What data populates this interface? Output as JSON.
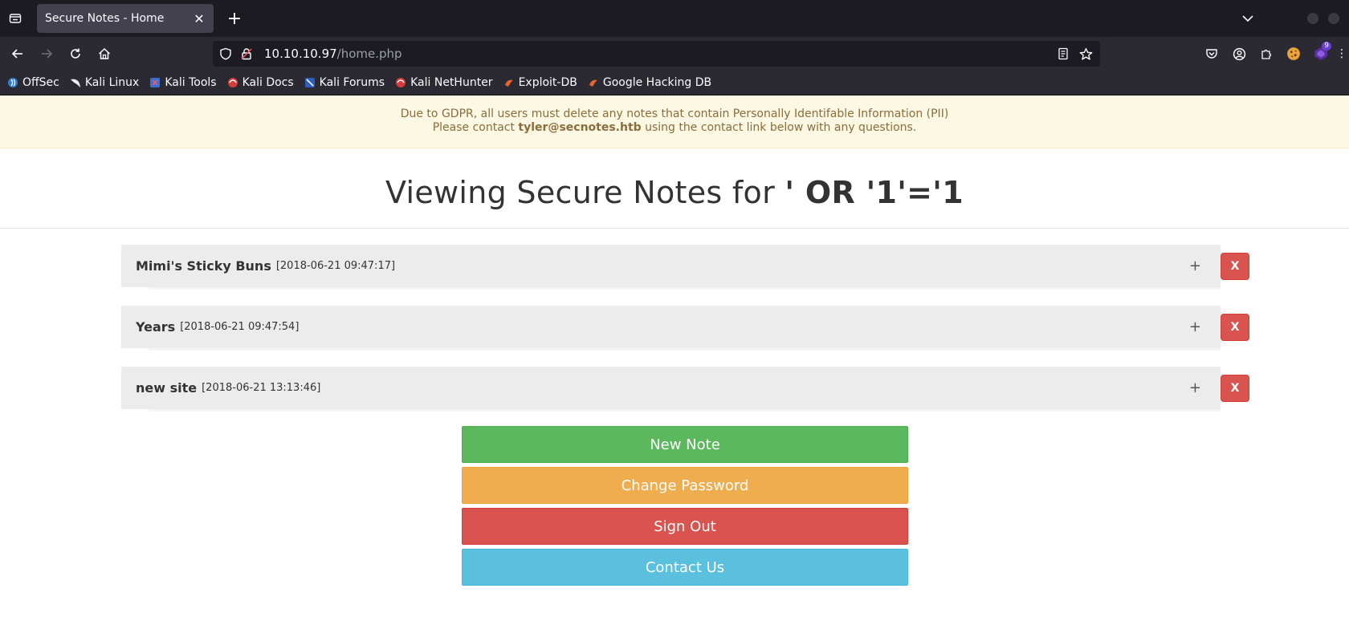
{
  "browser": {
    "tab_title": "Secure Notes - Home",
    "url_host": "10.10.10.97",
    "url_path": "/home.php",
    "extension_badge": "9",
    "bookmarks": [
      "OffSec",
      "Kali Linux",
      "Kali Tools",
      "Kali Docs",
      "Kali Forums",
      "Kali NetHunter",
      "Exploit-DB",
      "Google Hacking DB"
    ]
  },
  "banner": {
    "line1": "Due to GDPR, all users must delete any notes that contain Personally Identifable Information (PII)",
    "line2_prefix": "Please contact ",
    "contact_email": "tyler@secnotes.htb",
    "line2_suffix": " using the contact link below with any questions."
  },
  "heading": {
    "prefix": "Viewing Secure Notes for ",
    "username": "' OR '1'='1"
  },
  "notes": [
    {
      "title": "Mimi's Sticky Buns",
      "date": "[2018-06-21 09:47:17]"
    },
    {
      "title": "Years",
      "date": "[2018-06-21 09:47:54]"
    },
    {
      "title": "new site",
      "date": "[2018-06-21 13:13:46]"
    }
  ],
  "note_expand_label": "+",
  "note_delete_label": "X",
  "actions": {
    "new_note": "New Note",
    "change_password": "Change Password",
    "sign_out": "Sign Out",
    "contact_us": "Contact Us"
  },
  "colors": {
    "banner_bg": "#fcf8e3",
    "banner_text": "#8a6d3b",
    "success": "#5cb85c",
    "warning": "#f0ad4e",
    "danger": "#d9534f",
    "info": "#5bc0de"
  }
}
